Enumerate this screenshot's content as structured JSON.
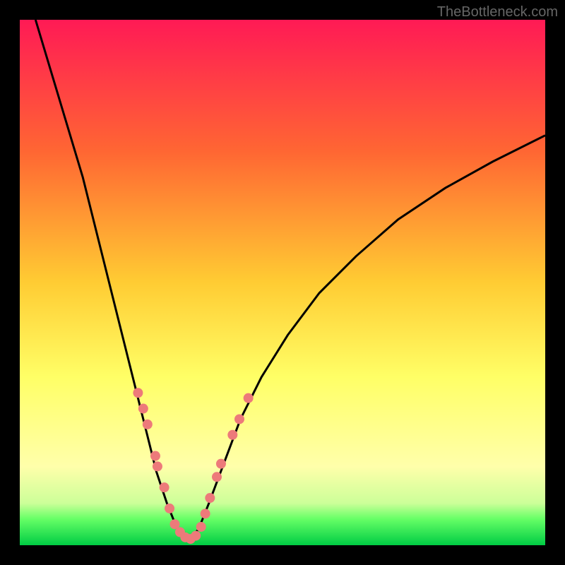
{
  "watermark": "TheBottleneck.com",
  "chart_data": {
    "type": "line",
    "title": "",
    "xlabel": "",
    "ylabel": "",
    "xlim": [
      0,
      100
    ],
    "ylim": [
      0,
      100
    ],
    "gradient_colors": [
      {
        "stop": 0,
        "color": "#ff1a55"
      },
      {
        "stop": 0.25,
        "color": "#ff6633"
      },
      {
        "stop": 0.5,
        "color": "#ffcc33"
      },
      {
        "stop": 0.68,
        "color": "#ffff66"
      },
      {
        "stop": 0.85,
        "color": "#ffffaa"
      },
      {
        "stop": 0.92,
        "color": "#ccff99"
      },
      {
        "stop": 0.95,
        "color": "#66ff66"
      },
      {
        "stop": 1,
        "color": "#00cc44"
      }
    ],
    "left_curve": [
      {
        "x": 3,
        "y": 100
      },
      {
        "x": 6,
        "y": 90
      },
      {
        "x": 9,
        "y": 80
      },
      {
        "x": 12,
        "y": 70
      },
      {
        "x": 15,
        "y": 58
      },
      {
        "x": 18,
        "y": 46
      },
      {
        "x": 20,
        "y": 38
      },
      {
        "x": 22,
        "y": 30
      },
      {
        "x": 24,
        "y": 22
      },
      {
        "x": 26,
        "y": 14
      },
      {
        "x": 28,
        "y": 8
      },
      {
        "x": 30,
        "y": 3
      },
      {
        "x": 32,
        "y": 1
      }
    ],
    "right_curve": [
      {
        "x": 32,
        "y": 1
      },
      {
        "x": 34,
        "y": 3
      },
      {
        "x": 36,
        "y": 8
      },
      {
        "x": 39,
        "y": 16
      },
      {
        "x": 42,
        "y": 24
      },
      {
        "x": 46,
        "y": 32
      },
      {
        "x": 51,
        "y": 40
      },
      {
        "x": 57,
        "y": 48
      },
      {
        "x": 64,
        "y": 55
      },
      {
        "x": 72,
        "y": 62
      },
      {
        "x": 81,
        "y": 68
      },
      {
        "x": 90,
        "y": 73
      },
      {
        "x": 100,
        "y": 78
      }
    ],
    "markers_left": [
      {
        "x": 22.5,
        "y": 29
      },
      {
        "x": 23.5,
        "y": 26
      },
      {
        "x": 24.3,
        "y": 23
      },
      {
        "x": 25.8,
        "y": 17
      },
      {
        "x": 26.2,
        "y": 15
      },
      {
        "x": 27.5,
        "y": 11
      },
      {
        "x": 28.5,
        "y": 7
      },
      {
        "x": 29.5,
        "y": 4
      },
      {
        "x": 30.5,
        "y": 2.5
      },
      {
        "x": 31.5,
        "y": 1.5
      },
      {
        "x": 32.5,
        "y": 1.2
      }
    ],
    "markers_right": [
      {
        "x": 33.5,
        "y": 1.8
      },
      {
        "x": 34.5,
        "y": 3.5
      },
      {
        "x": 35.3,
        "y": 6
      },
      {
        "x": 36.2,
        "y": 9
      },
      {
        "x": 37.5,
        "y": 13
      },
      {
        "x": 38.3,
        "y": 15.5
      },
      {
        "x": 40.5,
        "y": 21
      },
      {
        "x": 41.8,
        "y": 24
      },
      {
        "x": 43.5,
        "y": 28
      }
    ],
    "marker_color": "#ed7a7a",
    "curve_color": "#000000",
    "curve_width": 3,
    "marker_radius": 7
  }
}
